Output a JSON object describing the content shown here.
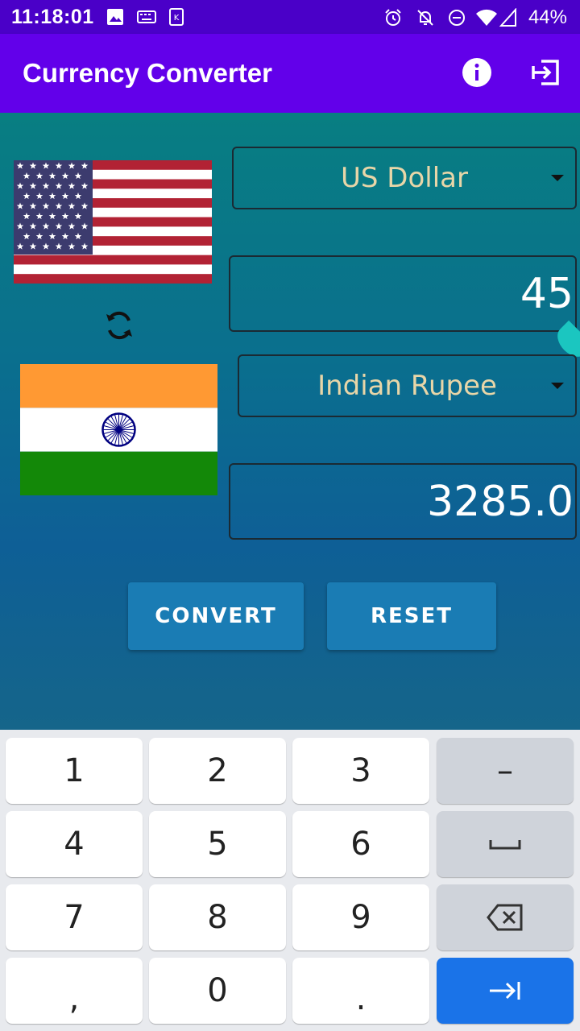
{
  "status_bar": {
    "time": "11:18:01",
    "battery": "44%"
  },
  "app_bar": {
    "title": "Currency Converter",
    "icons": [
      "info-icon",
      "exit-icon"
    ]
  },
  "converter": {
    "from_currency": "US Dollar",
    "from_amount": "45",
    "to_currency": "Indian Rupee",
    "to_amount": "3285.0",
    "convert_label": "CONVERT",
    "reset_label": "RESET"
  },
  "keyboard": {
    "keys": [
      "1",
      "2",
      "3",
      "–",
      "4",
      "5",
      "6",
      "␣",
      "7",
      "8",
      "9",
      "⌫",
      ",",
      "0",
      ".",
      "⇥"
    ]
  },
  "colors": {
    "app_bar": "#6200ea",
    "status_bar": "#4a00c8",
    "button": "#1a7cb4",
    "dropdown_text": "#e8d6a8",
    "action_key": "#1a73e8"
  }
}
